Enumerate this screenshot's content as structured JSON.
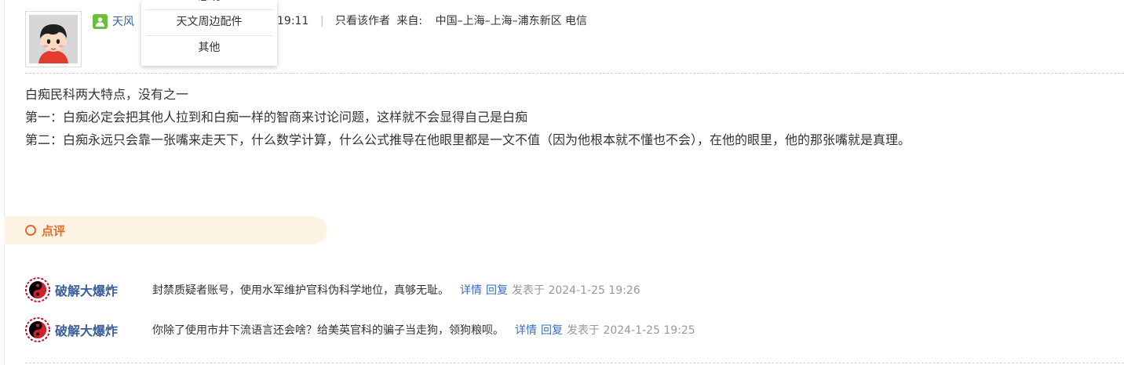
{
  "post": {
    "author": "天风",
    "time_tail": "19:11",
    "separator": "|",
    "author_only": "只看该作者",
    "from_label": "来自:",
    "location": "中国–上海–上海–浦东新区 电信",
    "body": [
      "白痴民科两大特点，没有之一",
      "第一：白痴必定会把其他人拉到和白痴一样的智商来讨论问题，这样就不会显得自己是白痴",
      "第二：白痴永远只会靠一张嘴来走天下，什么数学计算，什么公式推导在他眼里都是一文不值（因为他根本就不懂也不会），在他的眼里，他的那张嘴就是真理。"
    ]
  },
  "dropdown": {
    "items": [
      "天文周边配件",
      "其他"
    ],
    "cut_item": "感观"
  },
  "rating": {
    "label": "点评"
  },
  "comments": [
    {
      "user": "破解大爆炸",
      "text": "封禁质疑者账号，使用水军维护官科伪科学地位，真够无耻。",
      "detail": "详情",
      "reply": "回复",
      "posted_at": "发表于 2024-1-25 19:26"
    },
    {
      "user": "破解大爆炸",
      "text": "你除了使用市井下流语言还会啥？给美英官科的骗子当走狗，领狗粮呗。",
      "detail": "详情",
      "reply": "回复",
      "posted_at": "发表于 2024-1-25 19:25"
    }
  ],
  "colors": {
    "link": "#3a5f9c",
    "accent": "#e46a2c",
    "rating_bg": "#fdf3e3",
    "user_icon": "#6cbf3a"
  }
}
